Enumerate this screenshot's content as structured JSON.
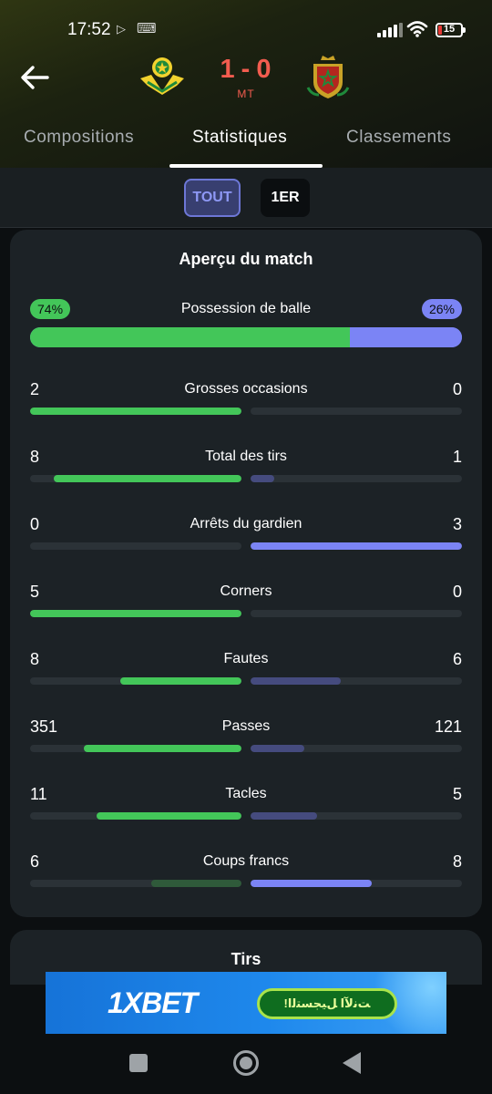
{
  "status_bar": {
    "time": "17:52",
    "battery": "15"
  },
  "match": {
    "home_score": "1",
    "away_score": "0",
    "separator": "-",
    "status": "MT"
  },
  "tabs": [
    {
      "label": "Compositions",
      "active": false
    },
    {
      "label": "Statistiques",
      "active": true
    },
    {
      "label": "Classements",
      "active": false
    }
  ],
  "filters": [
    {
      "label": "TOUT",
      "active": true
    },
    {
      "label": "1ER",
      "active": false
    }
  ],
  "overview": {
    "title": "Aperçu du match",
    "possession": {
      "label": "Possession de balle",
      "home": "74%",
      "away": "26%",
      "home_value": 74,
      "away_value": 26
    },
    "stats": [
      {
        "label": "Grosses occasions",
        "home": "2",
        "away": "0",
        "home_value": 2,
        "away_value": 0
      },
      {
        "label": "Total des tirs",
        "home": "8",
        "away": "1",
        "home_value": 8,
        "away_value": 1
      },
      {
        "label": "Arrêts du gardien",
        "home": "0",
        "away": "3",
        "home_value": 0,
        "away_value": 3
      },
      {
        "label": "Corners",
        "home": "5",
        "away": "0",
        "home_value": 5,
        "away_value": 0
      },
      {
        "label": "Fautes",
        "home": "8",
        "away": "6",
        "home_value": 8,
        "away_value": 6
      },
      {
        "label": "Passes",
        "home": "351",
        "away": "121",
        "home_value": 351,
        "away_value": 121
      },
      {
        "label": "Tacles",
        "home": "11",
        "away": "5",
        "home_value": 11,
        "away_value": 5
      },
      {
        "label": "Coups francs",
        "home": "6",
        "away": "8",
        "home_value": 6,
        "away_value": 8
      }
    ]
  },
  "shots_section": {
    "title": "Tirs"
  },
  "ad": {
    "brand": "1XBET",
    "cta": "!ﺖﻧﻵا ﻞﻴﺠﺴﺘﻟا"
  },
  "colors": {
    "home": "#43c659",
    "home_dim": "#2f5a3a",
    "away": "#7b84f5",
    "away_dim": "#454b7e",
    "score": "#f25c4f"
  }
}
